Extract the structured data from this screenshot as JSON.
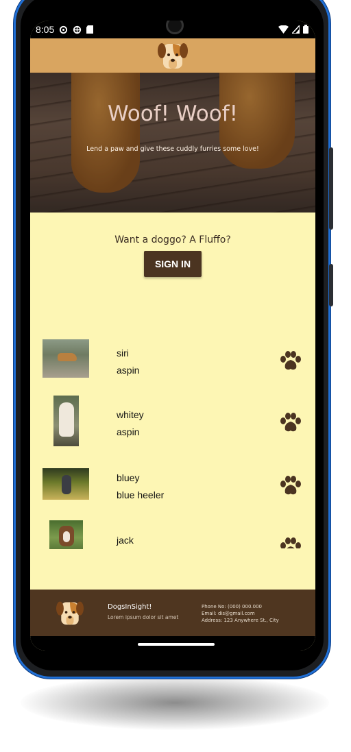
{
  "status_bar": {
    "time": "8:05",
    "icons_left": [
      "settings-icon",
      "settings-icon",
      "sd-card-icon"
    ],
    "icons_right": [
      "wifi-icon",
      "signal-icon",
      "battery-icon"
    ]
  },
  "app": {
    "brand_color": "#d9a560",
    "background_color": "#fdf6b4",
    "accent_dark": "#4b3421",
    "logo_icon": "dog-face-icon"
  },
  "hero": {
    "title": "Woof! Woof!",
    "subtitle": "Lend a paw and give these cuddly furries some love!"
  },
  "cta": {
    "text": "Want a doggo? A Fluffo?",
    "button_label": "SIGN IN"
  },
  "dogs": [
    {
      "name": "siri",
      "breed": "aspin",
      "action_icon": "paw-icon"
    },
    {
      "name": "whitey",
      "breed": "aspin",
      "action_icon": "paw-icon"
    },
    {
      "name": "bluey",
      "breed": "blue heeler",
      "action_icon": "paw-icon"
    },
    {
      "name": "jack",
      "breed": "",
      "action_icon": "paw-icon"
    }
  ],
  "footer": {
    "brand": "DogsInSight!",
    "tagline": "Lorem ipsum dolor sit amet",
    "phone": "Phone No: (000) 000.000",
    "email": "Email: dis@gmail.com",
    "address": "Address: 123 Anywhere St., City"
  }
}
